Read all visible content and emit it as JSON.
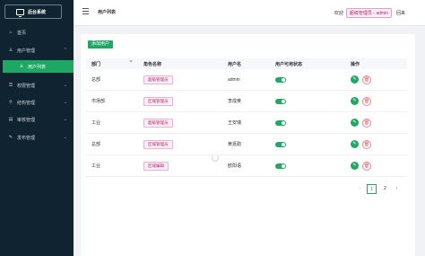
{
  "brand": {
    "title": "后台系统"
  },
  "sidebar": {
    "items": [
      {
        "label": "首页",
        "icon": "home-icon"
      },
      {
        "label": "用户管理",
        "icon": "user-icon",
        "expanded": true
      },
      {
        "label": "用户列表",
        "icon": "user-icon",
        "active": true
      },
      {
        "label": "权限管理",
        "icon": "key-icon"
      },
      {
        "label": "结构管理",
        "icon": "structure-icon"
      },
      {
        "label": "审核管理",
        "icon": "audit-icon"
      },
      {
        "label": "发布管理",
        "icon": "publish-icon"
      }
    ]
  },
  "header": {
    "title": "用户列表",
    "welcome": "欢迎",
    "role_user": "超级管理员 - admin",
    "logout": "回来"
  },
  "main": {
    "add_button": "添加用户",
    "columns": [
      "部门",
      "角色名称",
      "用户名",
      "用户可用状态",
      "操作"
    ],
    "rows": [
      {
        "dept": "总部",
        "role": "超级管理员",
        "username": "admin",
        "enabled": true
      },
      {
        "dept": "市场部",
        "role": "区域管理员",
        "username": "李成黄",
        "enabled": true
      },
      {
        "dept": "工业",
        "role": "超级管理员",
        "username": "王安瑞",
        "enabled": true
      },
      {
        "dept": "总部",
        "role": "区域管理员",
        "username": "黄嘉勤",
        "enabled": true
      },
      {
        "dept": "工业",
        "role": "区域编辑",
        "username": "欧阳语",
        "enabled": true
      }
    ],
    "pagination": {
      "prev": "‹",
      "pages": [
        "1",
        "2"
      ],
      "current": "1",
      "next": "›"
    }
  },
  "colors": {
    "accent": "#1fa864",
    "sidebar_bg": "#0f2330",
    "tag": "#b01d6f",
    "delete": "#e35b62"
  }
}
